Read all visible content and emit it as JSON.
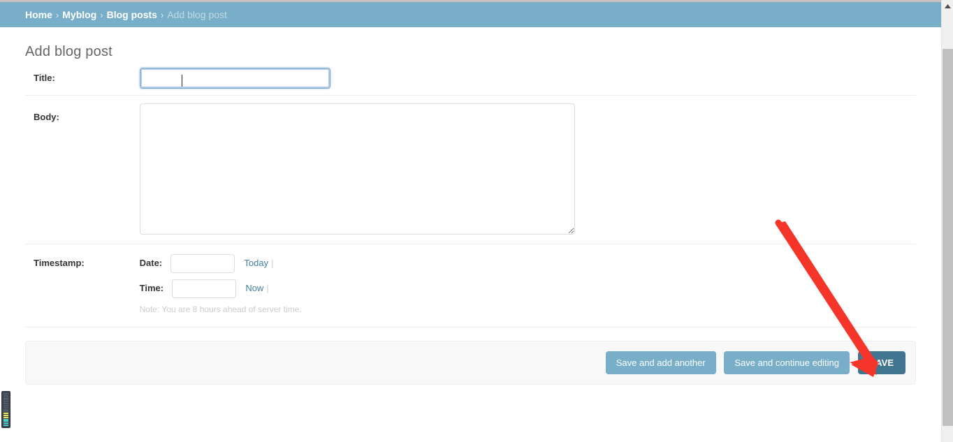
{
  "breadcrumbs": {
    "items": [
      {
        "label": "Home",
        "current": false
      },
      {
        "label": "Myblog",
        "current": false
      },
      {
        "label": "Blog posts",
        "current": false
      },
      {
        "label": "Add blog post",
        "current": true
      }
    ],
    "separator": "›"
  },
  "page": {
    "title": "Add blog post"
  },
  "form": {
    "title_field": {
      "label": "Title:",
      "value": "",
      "placeholder": ""
    },
    "body_field": {
      "label": "Body:",
      "value": "",
      "placeholder": ""
    },
    "timestamp_field": {
      "label": "Timestamp:",
      "date": {
        "label": "Date:",
        "value": "",
        "placeholder": "",
        "shortcut": "Today",
        "pipe": "|"
      },
      "time": {
        "label": "Time:",
        "value": "",
        "placeholder": "",
        "shortcut": "Now",
        "pipe": "|"
      },
      "note": "Note: You are 8 hours ahead of server time."
    }
  },
  "submit_row": {
    "save_and_add_another": "Save and add another",
    "save_and_continue": "Save and continue editing",
    "save": "SAVE"
  },
  "colors": {
    "header_blue": "#79aec8",
    "save_button": "#417690",
    "link_blue": "#447e9b",
    "annotation_red": "#f5342a",
    "focus_border": "#7aa7d0"
  },
  "annotation": {
    "arrow_target": "save-button",
    "color": "#f5342a"
  },
  "scrollbar": {
    "orientation": "vertical",
    "arrow_icon": "caret-up-icon"
  },
  "level_meter": {
    "name": "audio-level-meter",
    "segments": [
      "#525c69",
      "#525c69",
      "#525c69",
      "#525c69",
      "#525c69",
      "#525c69",
      "#525c69",
      "#525c69",
      "#525c69",
      "#525c69",
      "#e8e35c",
      "#e8e35c",
      "#e8e35c",
      "#4ecdc4",
      "#4ecdc4",
      "#4ecdc4",
      "#4ecdc4"
    ]
  }
}
